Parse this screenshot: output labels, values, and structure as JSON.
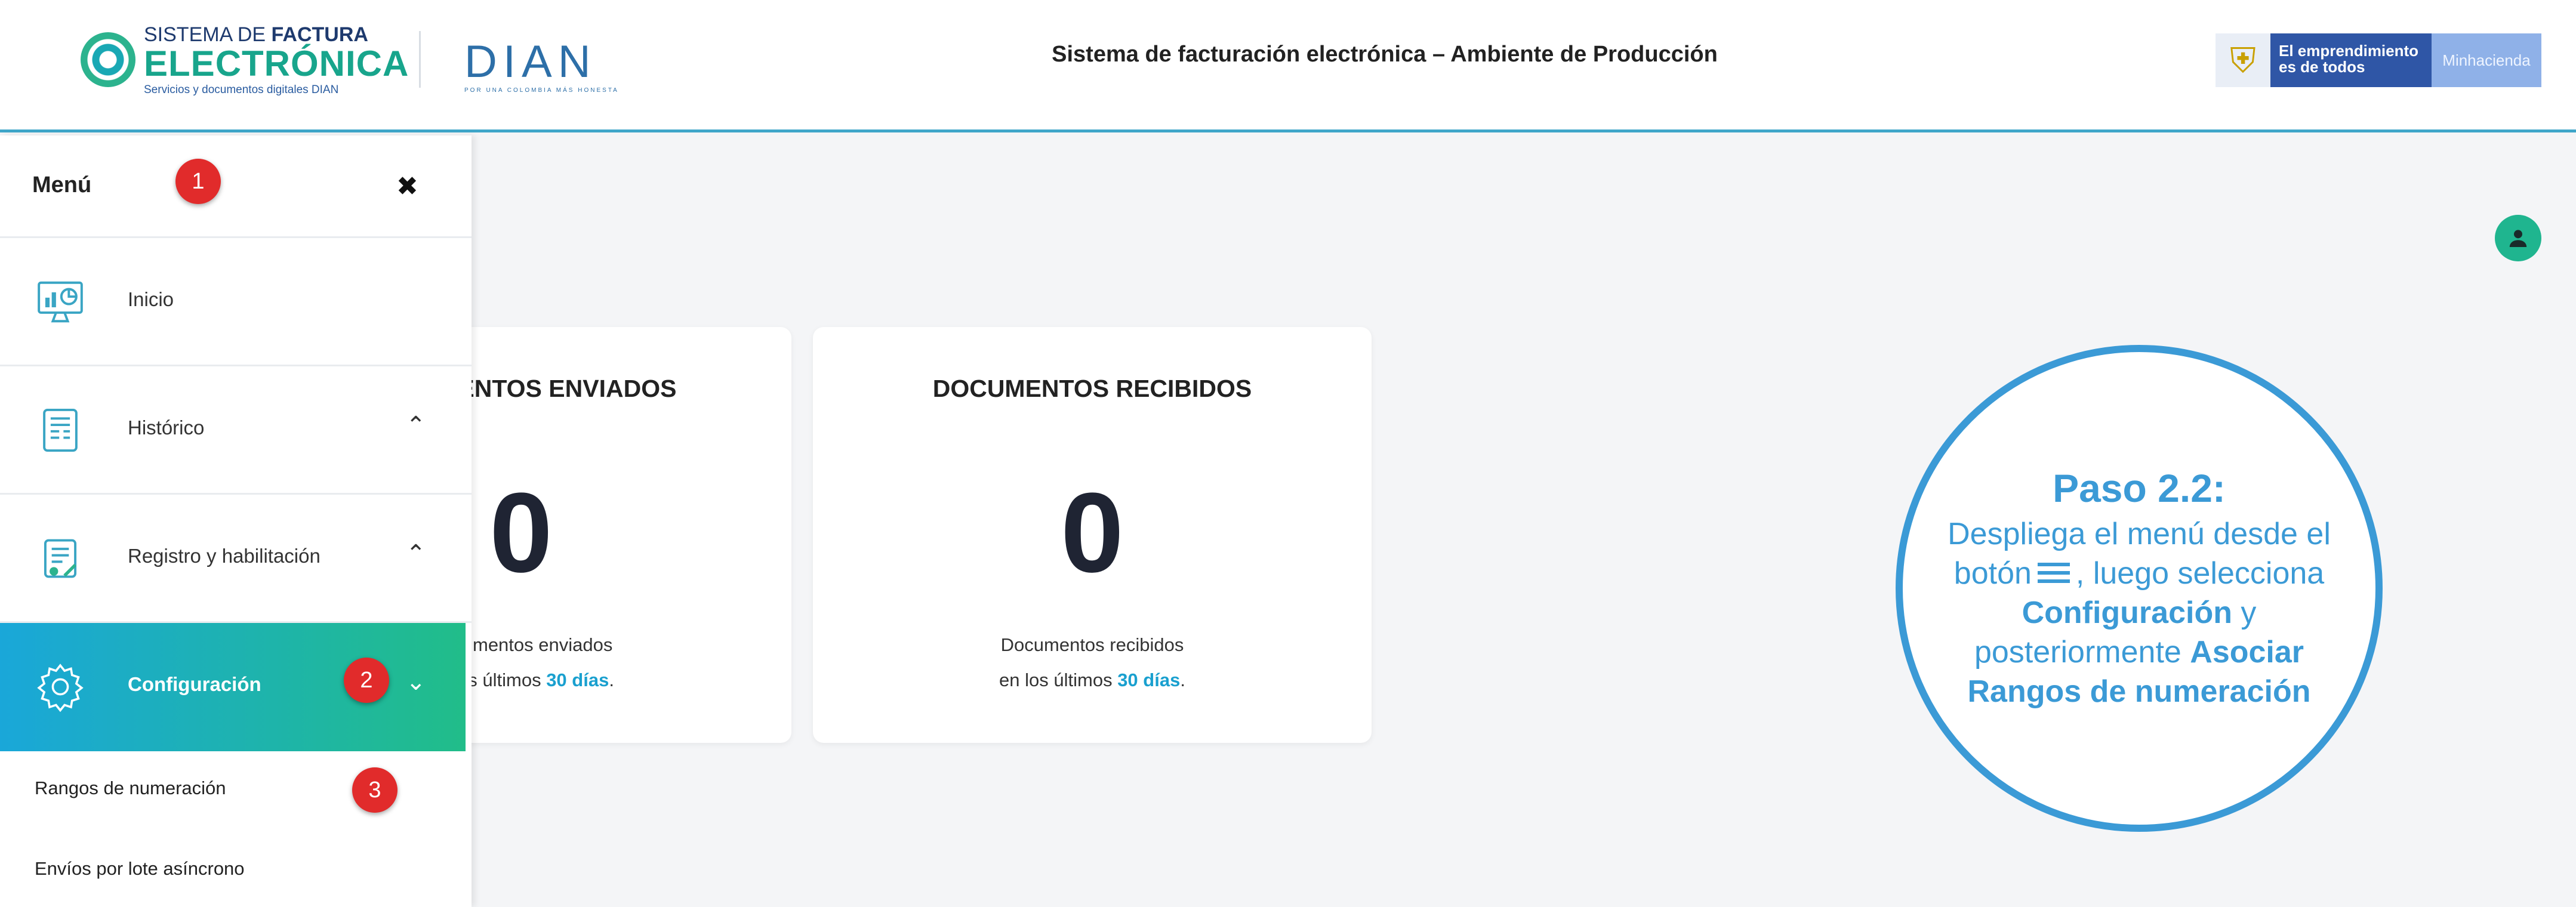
{
  "header": {
    "sfe_line1_a": "SISTEMA DE ",
    "sfe_line1_b": "FACTURA",
    "sfe_line2": "ELECTRÓNICA",
    "sfe_line3": "Servicios y documentos digitales DIAN",
    "dian_word": "DIAN",
    "dian_tagline": "POR UNA COLOMBIA MÁS HONESTA",
    "title": "Sistema de facturación electrónica – Ambiente de Producción",
    "brand_line1": "El emprendimiento",
    "brand_line2": "es de todos",
    "brand_ministry": "Minhacienda"
  },
  "sidebar": {
    "title": "Menú",
    "close_icon": "close-icon",
    "items": [
      {
        "label": "Inicio",
        "icon": "dashboard-icon",
        "expandable": false
      },
      {
        "label": "Histórico",
        "icon": "document-list-icon",
        "expandable": true
      },
      {
        "label": "Registro y habilitación",
        "icon": "registration-icon",
        "expandable": true
      },
      {
        "label": "Configuración",
        "icon": "gear-icon",
        "expandable": true,
        "active": true
      }
    ],
    "subitems": [
      "Rangos de numeración",
      "Envíos por lote asíncrono"
    ]
  },
  "badges": [
    "1",
    "2",
    "3"
  ],
  "cards": [
    {
      "title": "DOCUMENTOS ENVIADOS",
      "count": "0",
      "line1": "Documentos enviados",
      "line2_prefix": "en los últimos ",
      "line2_bold": "30 días",
      "line2_suffix": "."
    },
    {
      "title": "DOCUMENTOS RECIBIDOS",
      "count": "0",
      "line1": "Documentos recibidos",
      "line2_prefix": "en los últimos ",
      "line2_bold": "30 días",
      "line2_suffix": "."
    }
  ],
  "callout": {
    "heading": "Paso 2.2:",
    "text1": "Despliega el menú desde el botón",
    "text2": ", luego selecciona",
    "bold1": "Configuración",
    "text3": " y posteriormente ",
    "bold2": "Asociar Rangos de numeración"
  },
  "colors": {
    "accent_blue": "#1aa7d9",
    "accent_green": "#21bd89",
    "badge_red": "#e12b2b",
    "callout_blue": "#3b9ad6"
  }
}
